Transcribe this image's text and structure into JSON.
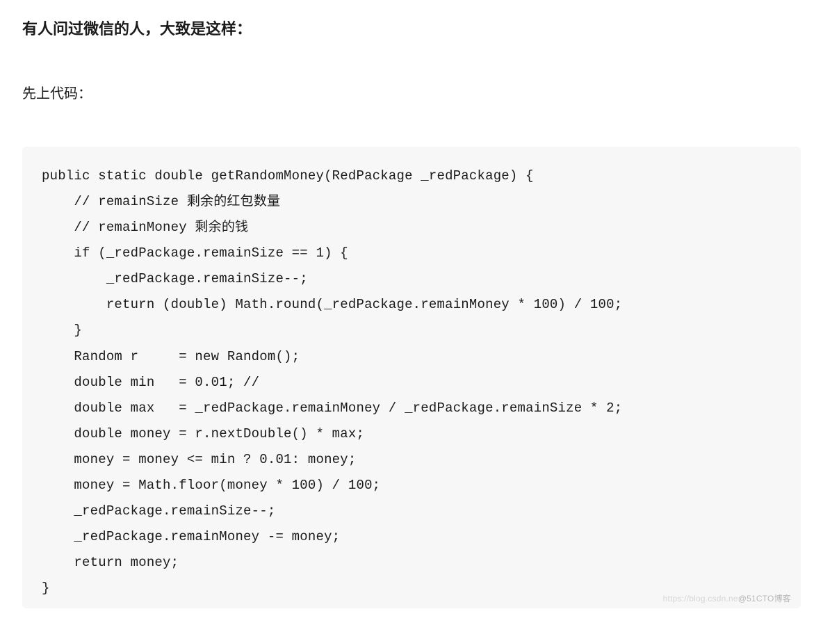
{
  "heading": "有人问过微信的人，大致是这样：",
  "subtext": "先上代码：",
  "code": "public static double getRandomMoney(RedPackage _redPackage) {\n    // remainSize 剩余的红包数量\n    // remainMoney 剩余的钱\n    if (_redPackage.remainSize == 1) {\n        _redPackage.remainSize--;\n        return (double) Math.round(_redPackage.remainMoney * 100) / 100;\n    }\n    Random r     = new Random();\n    double min   = 0.01; //\n    double max   = _redPackage.remainMoney / _redPackage.remainSize * 2;\n    double money = r.nextDouble() * max;\n    money = money <= min ? 0.01: money;\n    money = Math.floor(money * 100) / 100;\n    _redPackage.remainSize--;\n    _redPackage.remainMoney -= money;\n    return money;\n}",
  "watermark_faint": "https://blog.csdn.ne",
  "watermark_main": "@51CTO博客"
}
